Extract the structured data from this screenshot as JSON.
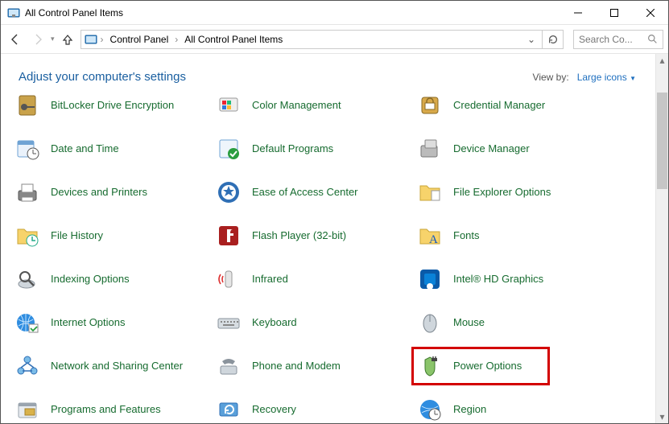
{
  "window": {
    "title": "All Control Panel Items"
  },
  "breadcrumb": {
    "root": "Control Panel",
    "current": "All Control Panel Items"
  },
  "search": {
    "placeholder": "Search Co..."
  },
  "header": {
    "heading": "Adjust your computer's settings"
  },
  "viewby": {
    "label": "View by:",
    "value": "Large icons"
  },
  "items": [
    {
      "label": "BitLocker Drive Encryption",
      "icon": "bitlocker-icon"
    },
    {
      "label": "Color Management",
      "icon": "color-management-icon"
    },
    {
      "label": "Credential Manager",
      "icon": "credential-manager-icon"
    },
    {
      "label": "Date and Time",
      "icon": "date-time-icon"
    },
    {
      "label": "Default Programs",
      "icon": "default-programs-icon"
    },
    {
      "label": "Device Manager",
      "icon": "device-manager-icon"
    },
    {
      "label": "Devices and Printers",
      "icon": "devices-printers-icon"
    },
    {
      "label": "Ease of Access Center",
      "icon": "ease-of-access-icon"
    },
    {
      "label": "File Explorer Options",
      "icon": "file-explorer-options-icon"
    },
    {
      "label": "File History",
      "icon": "file-history-icon"
    },
    {
      "label": "Flash Player (32-bit)",
      "icon": "flash-player-icon"
    },
    {
      "label": "Fonts",
      "icon": "fonts-icon"
    },
    {
      "label": "Indexing Options",
      "icon": "indexing-options-icon"
    },
    {
      "label": "Infrared",
      "icon": "infrared-icon"
    },
    {
      "label": "Intel® HD Graphics",
      "icon": "intel-graphics-icon"
    },
    {
      "label": "Internet Options",
      "icon": "internet-options-icon"
    },
    {
      "label": "Keyboard",
      "icon": "keyboard-icon"
    },
    {
      "label": "Mouse",
      "icon": "mouse-icon"
    },
    {
      "label": "Network and Sharing Center",
      "icon": "network-sharing-icon"
    },
    {
      "label": "Phone and Modem",
      "icon": "phone-modem-icon"
    },
    {
      "label": "Power Options",
      "icon": "power-options-icon"
    },
    {
      "label": "Programs and Features",
      "icon": "programs-features-icon"
    },
    {
      "label": "Recovery",
      "icon": "recovery-icon"
    },
    {
      "label": "Region",
      "icon": "region-icon"
    }
  ],
  "highlight_index": 20
}
